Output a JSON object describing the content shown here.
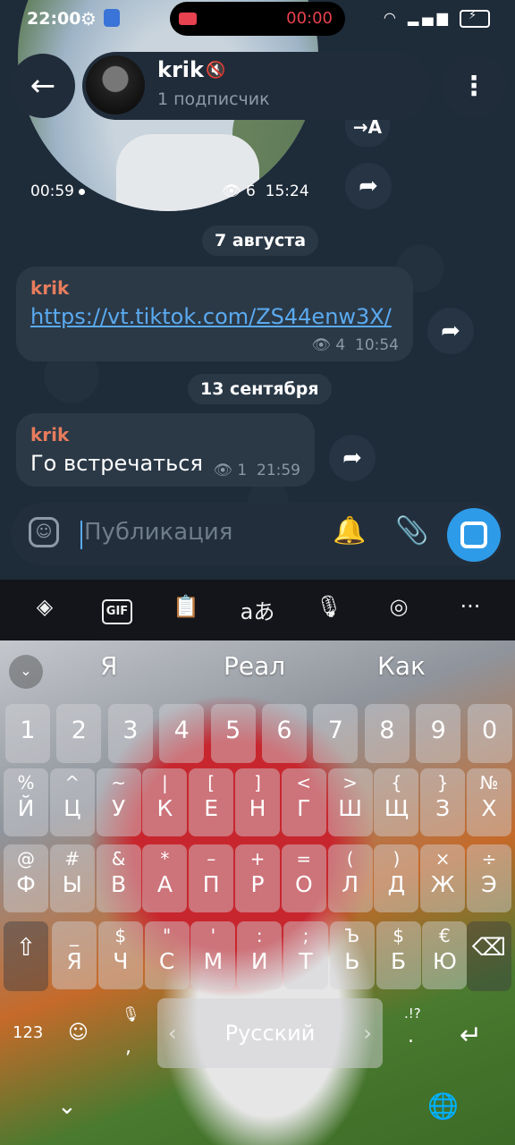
{
  "status_bar": {
    "time": "22:00",
    "record_time": "00:00"
  },
  "header": {
    "channel_name": "krik",
    "subscribers": "1 подписчик"
  },
  "round_video": {
    "duration": "00:59",
    "views": "6",
    "time": "15:24"
  },
  "translate_label": "→A",
  "messages": [
    {
      "date": "7 августа",
      "author": "krik",
      "link": "https://vt.tiktok.com/ZS44enw3X/",
      "views": "4",
      "time": "10:54"
    },
    {
      "date": "13 сентября",
      "author": "krik",
      "text": "Го встречаться",
      "views": "1",
      "time": "21:59"
    }
  ],
  "input": {
    "placeholder": "Публикация"
  },
  "keyboard": {
    "toolbar_more": "···",
    "toolbar_translate": "aあ",
    "suggestions": [
      "Я",
      "Реал",
      "Как"
    ],
    "numbers": [
      "1",
      "2",
      "3",
      "4",
      "5",
      "6",
      "7",
      "8",
      "9",
      "0"
    ],
    "row1": [
      {
        "s": "%",
        "l": "Й"
      },
      {
        "s": "^",
        "l": "Ц"
      },
      {
        "s": "~",
        "l": "У"
      },
      {
        "s": "|",
        "l": "К"
      },
      {
        "s": "[",
        "l": "Е"
      },
      {
        "s": "]",
        "l": "Н"
      },
      {
        "s": "<",
        "l": "Г"
      },
      {
        "s": ">",
        "l": "Ш"
      },
      {
        "s": "{",
        "l": "Щ"
      },
      {
        "s": "}",
        "l": "З"
      },
      {
        "s": "№",
        "l": "Х"
      }
    ],
    "row2": [
      {
        "s": "@",
        "l": "Ф"
      },
      {
        "s": "#",
        "l": "Ы"
      },
      {
        "s": "&",
        "l": "В"
      },
      {
        "s": "*",
        "l": "А"
      },
      {
        "s": "–",
        "l": "П"
      },
      {
        "s": "+",
        "l": "Р"
      },
      {
        "s": "=",
        "l": "О"
      },
      {
        "s": "(",
        "l": "Л"
      },
      {
        "s": ")",
        "l": "Д"
      },
      {
        "s": "×",
        "l": "Ж"
      },
      {
        "s": "÷",
        "l": "Э"
      }
    ],
    "row3": [
      {
        "s": "_",
        "l": "Я"
      },
      {
        "s": "$",
        "l": "Ч"
      },
      {
        "s": "\"",
        "l": "С"
      },
      {
        "s": "'",
        "l": "М"
      },
      {
        "s": ":",
        "l": "И"
      },
      {
        "s": ";",
        "l": "Т"
      },
      {
        "s": "Ъ",
        "l": "Ь"
      },
      {
        "s": "$",
        "l": "Б"
      },
      {
        "s": "€",
        "l": "Ю"
      }
    ],
    "numbers_key": "123",
    "comma": ",",
    "space_label": "Русский",
    "punct_key": ".!?",
    "punct_dot": "."
  }
}
